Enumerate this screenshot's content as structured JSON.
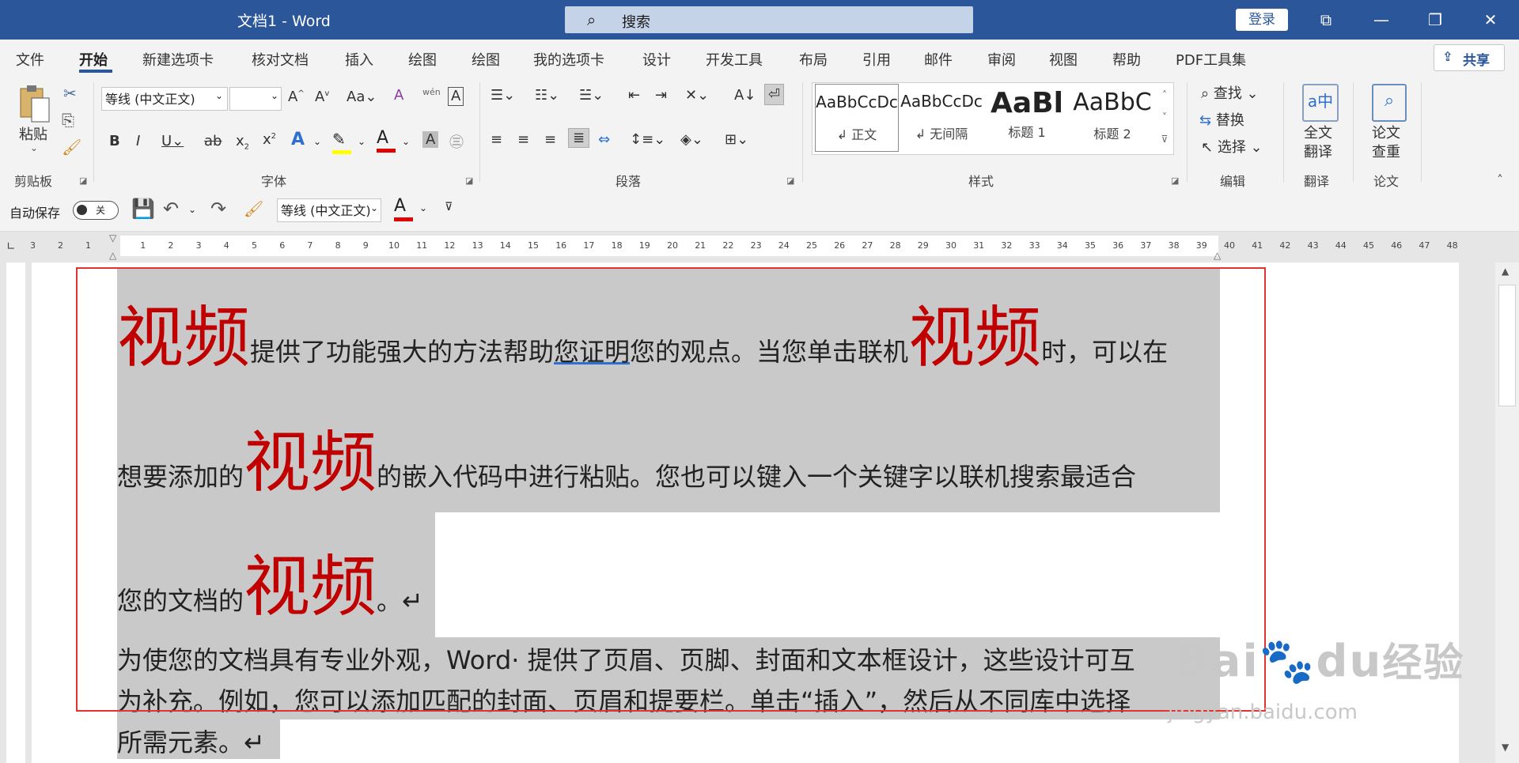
{
  "window": {
    "title": "文档1  -  Word",
    "search_placeholder": "搜索",
    "login_label": "登录"
  },
  "tabs": [
    "文件",
    "开始",
    "新建选项卡",
    "核对文档",
    "插入",
    "绘图",
    "绘图",
    "我的选项卡",
    "设计",
    "开发工具",
    "布局",
    "引用",
    "邮件",
    "审阅",
    "视图",
    "帮助",
    "PDF工具集"
  ],
  "active_tab": "开始",
  "share_label": "共享",
  "ribbon": {
    "clipboard": {
      "paste": "粘贴",
      "label": "剪贴板"
    },
    "font": {
      "font_name": "等线 (中文正文)",
      "font_size": "",
      "label": "字体",
      "phonetic": "wén"
    },
    "paragraph": {
      "label": "段落"
    },
    "styles": {
      "label": "样式",
      "items": [
        {
          "sample": "AaBbCcDc",
          "name": "↲ 正文"
        },
        {
          "sample": "AaBbCcDc",
          "name": "↲ 无间隔"
        },
        {
          "sample": "AaBl",
          "name": "标题 1"
        },
        {
          "sample": "AaBbC",
          "name": "标题 2"
        }
      ]
    },
    "editing": {
      "find": "查找",
      "replace": "替换",
      "select": "选择",
      "label": "编辑"
    },
    "translate": {
      "full": "全文",
      "trans": "翻译",
      "label": "翻译"
    },
    "thesis": {
      "a": "论文",
      "b": "查重",
      "label": "论文"
    }
  },
  "qat": {
    "autosave": "自动保存",
    "toggle": "关",
    "font_name": "等线 (中文正文)"
  },
  "ruler": {
    "left_ticks": [
      "3",
      "2",
      "1"
    ],
    "ticks": [
      "1",
      "2",
      "3",
      "4",
      "5",
      "6",
      "7",
      "8",
      "9",
      "10",
      "11",
      "12",
      "13",
      "14",
      "15",
      "16",
      "17",
      "18",
      "19",
      "20",
      "21",
      "22",
      "23",
      "24",
      "25",
      "26",
      "27",
      "28",
      "29",
      "30",
      "31",
      "32",
      "33",
      "34",
      "35",
      "36",
      "37",
      "38",
      "39",
      "40",
      "41",
      "42",
      "43",
      "44",
      "45",
      "46",
      "47",
      "48"
    ]
  },
  "document": {
    "line1": {
      "w1": "视频",
      "t1": "提供了功能强大的方法帮助",
      "t1u": "您证明",
      "t2": "您的观点。当您单击联机",
      "w2": "视频",
      "t3": "时，可以在"
    },
    "line2": {
      "t1": "想要添加的",
      "w1": "视频",
      "t2": "的嵌入代码中进行粘贴。您也可以键入一个关键字以联机搜索最适合"
    },
    "line3": {
      "t1": "您的文档的",
      "w1": "视频",
      "t2": "。↵"
    },
    "para2": {
      "l1": "为使您的文档具有专业外观，Word· 提供了页眉、页脚、封面和文本框设计，这些设计可互",
      "l2": "为补充。例如，您可以添加匹配的封面、页眉和提要栏。单击“插入”，然后从不同库中选择",
      "l3": "所需元素。↵"
    }
  },
  "watermark": {
    "brand": "Bai",
    "brand2": "du",
    "jingyan": "经验",
    "url": "jingyan.baidu.com"
  },
  "colors": {
    "titlebar": "#2b579a",
    "accent_red": "#c00000",
    "highlight": "#c9c9c9",
    "selection_frame": "#e03434"
  }
}
